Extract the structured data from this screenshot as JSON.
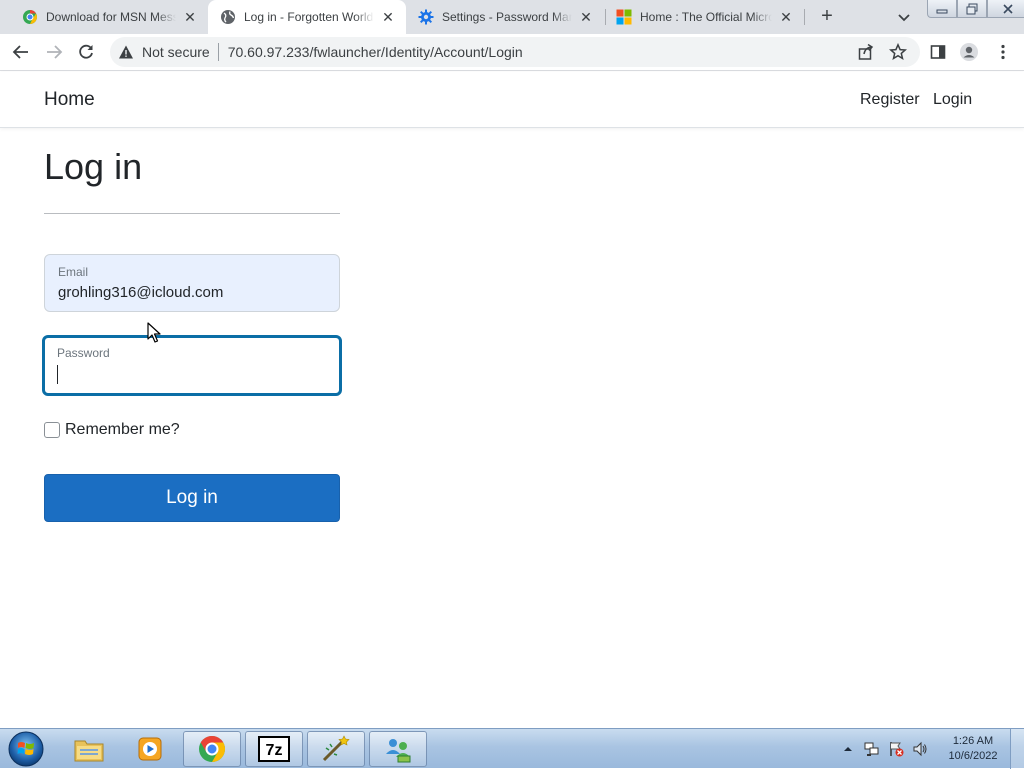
{
  "browser": {
    "tabs": [
      {
        "title": "Download for MSN Mess",
        "favicon": "chrome-download-icon",
        "active": false
      },
      {
        "title": "Log in - Forgotten World",
        "favicon": "globe-icon",
        "active": true
      },
      {
        "title": "Settings - Password Mana",
        "favicon": "settings-gear-icon",
        "active": false
      },
      {
        "title": "Home : The Official Micro",
        "favicon": "microsoft-logo-icon",
        "active": false
      }
    ],
    "security_label": "Not secure",
    "url": "70.60.97.233/fwlauncher/Identity/Account/Login"
  },
  "site_nav": {
    "brand": "Home",
    "links": [
      "Register",
      "Login"
    ]
  },
  "login": {
    "title": "Log in",
    "email_label": "Email",
    "email_value": "grohling316@icloud.com",
    "password_label": "Password",
    "password_value": "",
    "remember_label": "Remember me?",
    "remember_checked": false,
    "submit_label": "Log in"
  },
  "colors": {
    "primary_button": "#1b6ec2",
    "focus_border": "#0b6ea6",
    "autofill_bg": "#e8f0fe"
  },
  "taskbar": {
    "pinned": [
      "file-explorer-icon",
      "media-player-icon",
      "chrome-icon",
      "7zip-icon",
      "wand-tool-icon",
      "network-users-icon"
    ],
    "clock_time": "1:26 AM",
    "clock_date": "10/6/2022"
  }
}
